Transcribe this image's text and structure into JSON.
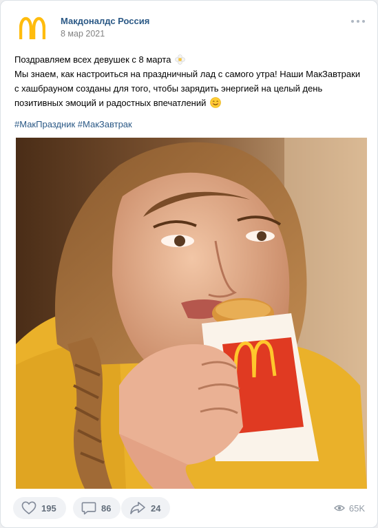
{
  "post": {
    "author": "Макдоналдс Россия",
    "date": "8 мар 2021",
    "text_lines": [
      "Поздравляем всех девушек с 8 марта",
      "Мы знаем, как настроиться на праздничный лад с самого утра! Наши МакЗавтраки с хашбрауном созданы для того, чтобы зарядить энергией на целый день позитивных эмоций и радостных впечатлений"
    ],
    "hashtags": [
      "#МакПраздник",
      "#МакЗавтрак"
    ],
    "logo_icon": "mcdonalds-arches-icon",
    "emojis": [
      "flower-icon",
      "smile-icon"
    ],
    "photo_icons": [
      "mcdonalds-arches-icon"
    ]
  },
  "footer": {
    "likes": "195",
    "comments": "86",
    "shares": "24",
    "views": "65K",
    "icons": [
      "heart-icon",
      "comment-icon",
      "share-icon",
      "eye-icon",
      "more-dots-icon"
    ]
  },
  "colors": {
    "link": "#2a5885",
    "brand_yellow": "#ffc72c",
    "brand_red": "#da291c",
    "counter": "#626d7a",
    "pill_bg": "#f0f2f5"
  }
}
